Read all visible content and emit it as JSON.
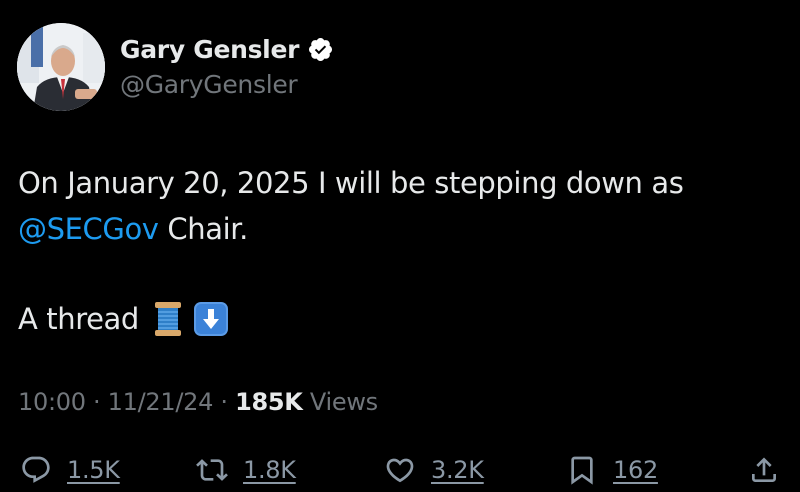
{
  "author": {
    "display_name": "Gary Gensler",
    "handle": "@GaryGensler",
    "verified_icon": "verified-badge-icon",
    "avatar_icon": "profile-photo"
  },
  "tweet": {
    "text_part1": "On January 20, 2025 I will be stepping down as",
    "mention": "@SECGov",
    "text_part2": " Chair.",
    "thread_text": "A thread",
    "emoji_1": "spool-of-thread-emoji",
    "emoji_2": "down-arrow-emoji"
  },
  "meta": {
    "time": "10:00",
    "separator": " · ",
    "date": "11/21/24",
    "views_count": "185K",
    "views_label": " Views"
  },
  "actions": {
    "replies": "1.5K",
    "reposts": "1.8K",
    "likes": "3.2K",
    "bookmarks": "162"
  },
  "colors": {
    "background": "#000000",
    "text": "#e7e9ea",
    "secondary": "#71767b",
    "accent": "#1d9bf0"
  }
}
